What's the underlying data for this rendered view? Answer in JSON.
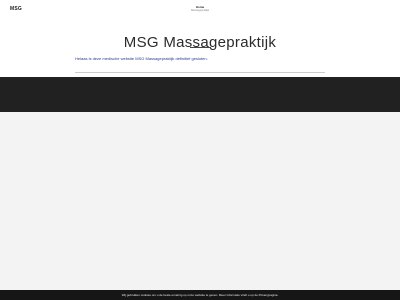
{
  "header": {
    "brand": "MSG",
    "nav": {
      "label": "Home",
      "sublabel": "Massagepraktijk"
    }
  },
  "main": {
    "title": "MSG  Massagepraktijk",
    "intro": "Helaas is deze medische website MSG Massagepraktijk definitief gesloten."
  },
  "cookie_notice": {
    "text": "Wij gebruiken cookies om u de beste ervaring op onze website te geven. Meer informatie vindt u op de Privacypagina."
  },
  "colors": {
    "dark_band": "#212121",
    "background_gray": "#f3f3f3",
    "intro_text": "#2a3a8c"
  }
}
